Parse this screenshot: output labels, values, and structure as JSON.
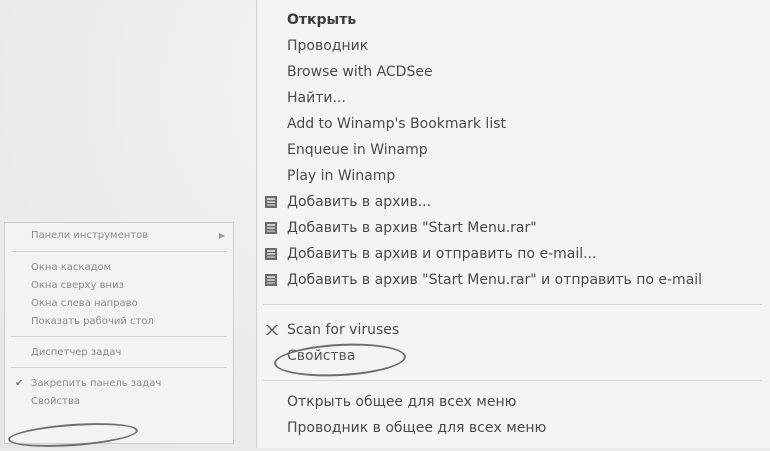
{
  "left_menu": {
    "items": [
      {
        "label": "Панели инструментов",
        "has_submenu": true
      },
      {
        "label": "Окна каскадом"
      },
      {
        "label": "Окна сверху вниз"
      },
      {
        "label": "Окна слева направо"
      },
      {
        "label": "Показать рабочий стол"
      },
      {
        "label": "Диспетчер задач"
      },
      {
        "label": "Закрепить панель задач",
        "checked": true
      },
      {
        "label": "Свойства",
        "highlighted_by_circle": true
      }
    ],
    "arrow_glyph": "▶",
    "check_glyph": "✔"
  },
  "right_menu": {
    "items": [
      {
        "label": "Открыть",
        "bold": true
      },
      {
        "label": "Проводник"
      },
      {
        "label": "Browse with ACDSee"
      },
      {
        "label": "Найти..."
      },
      {
        "label": "Add to Winamp's Bookmark list"
      },
      {
        "label": "Enqueue in Winamp"
      },
      {
        "label": "Play in Winamp"
      },
      {
        "label": "Добавить в архив...",
        "icon": "winrar-icon"
      },
      {
        "label": "Добавить в архив \"Start Menu.rar\"",
        "icon": "winrar-icon"
      },
      {
        "label": "Добавить в архив и отправить по e-mail...",
        "icon": "winrar-icon"
      },
      {
        "label": "Добавить в архив \"Start Menu.rar\" и отправить по e-mail",
        "icon": "winrar-icon"
      },
      {
        "label": "Scan for viruses",
        "icon": "antivirus-icon"
      },
      {
        "label": "Свойства",
        "highlighted_by_circle": true
      },
      {
        "label": "Открыть общее для всех меню"
      },
      {
        "label": "Проводник в общее для всех меню"
      }
    ]
  }
}
